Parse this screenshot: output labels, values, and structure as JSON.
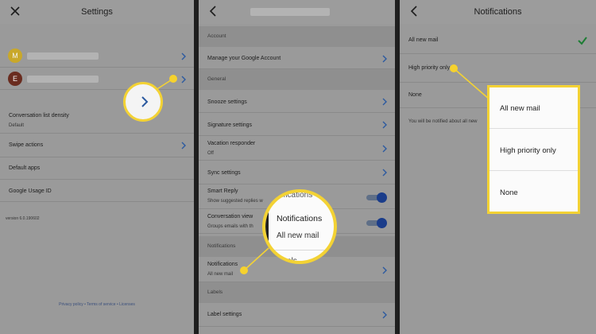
{
  "panel1": {
    "title": "Settings",
    "accounts": [
      {
        "initial": "M",
        "color": "#c9a82a"
      },
      {
        "initial": "E",
        "color": "#6a2c1f"
      }
    ],
    "items": [
      {
        "label": "Conversation list density",
        "sub": "Default"
      },
      {
        "label": "Swipe actions",
        "sub": ""
      },
      {
        "label": "Default apps",
        "sub": ""
      },
      {
        "label": "Google Usage ID",
        "sub": ""
      }
    ],
    "version": "version 6.0.190602",
    "footer": {
      "privacy": "Privacy policy",
      "terms": "Terms of service",
      "licenses": "Licenses",
      "separator": "•"
    }
  },
  "panel2": {
    "sections": {
      "account": "Account",
      "general": "General",
      "notifications": "Notifications",
      "labels": "Labels"
    },
    "items": {
      "manage_account": "Manage your Google Account",
      "snooze": "Snooze settings",
      "signature": "Signature settings",
      "vacation": "Vacation responder",
      "vacation_sub": "Off",
      "sync": "Sync settings",
      "smart_reply": "Smart Reply",
      "smart_reply_sub": "Show suggested replies w",
      "conversation_view": "Conversation view",
      "conversation_view_sub": "Groups emails with th",
      "notifications": "Notifications",
      "notifications_sub": "All new mail",
      "label_settings": "Label settings"
    },
    "magnifier": {
      "fragment_top": "otifications",
      "title": "Notifications",
      "sub": "All new mail",
      "fragment_bottom": "abels"
    }
  },
  "panel3": {
    "title": "Notifications",
    "options": [
      "All new mail",
      "High priority only",
      "None"
    ],
    "info": "You will be notified about all new",
    "popup_options": [
      "All new mail",
      "High priority only",
      "None"
    ]
  },
  "colors": {
    "panel_bg": "#9a9a9a",
    "highlight": "#f3d234",
    "chevron": "#2c5aa0",
    "check": "#1d7d34",
    "toggle": "#1a3c8a"
  },
  "icons": {
    "close": "close-icon",
    "back": "back-arrow-icon",
    "chevron": "chevron-right-icon",
    "check": "checkmark-icon"
  }
}
